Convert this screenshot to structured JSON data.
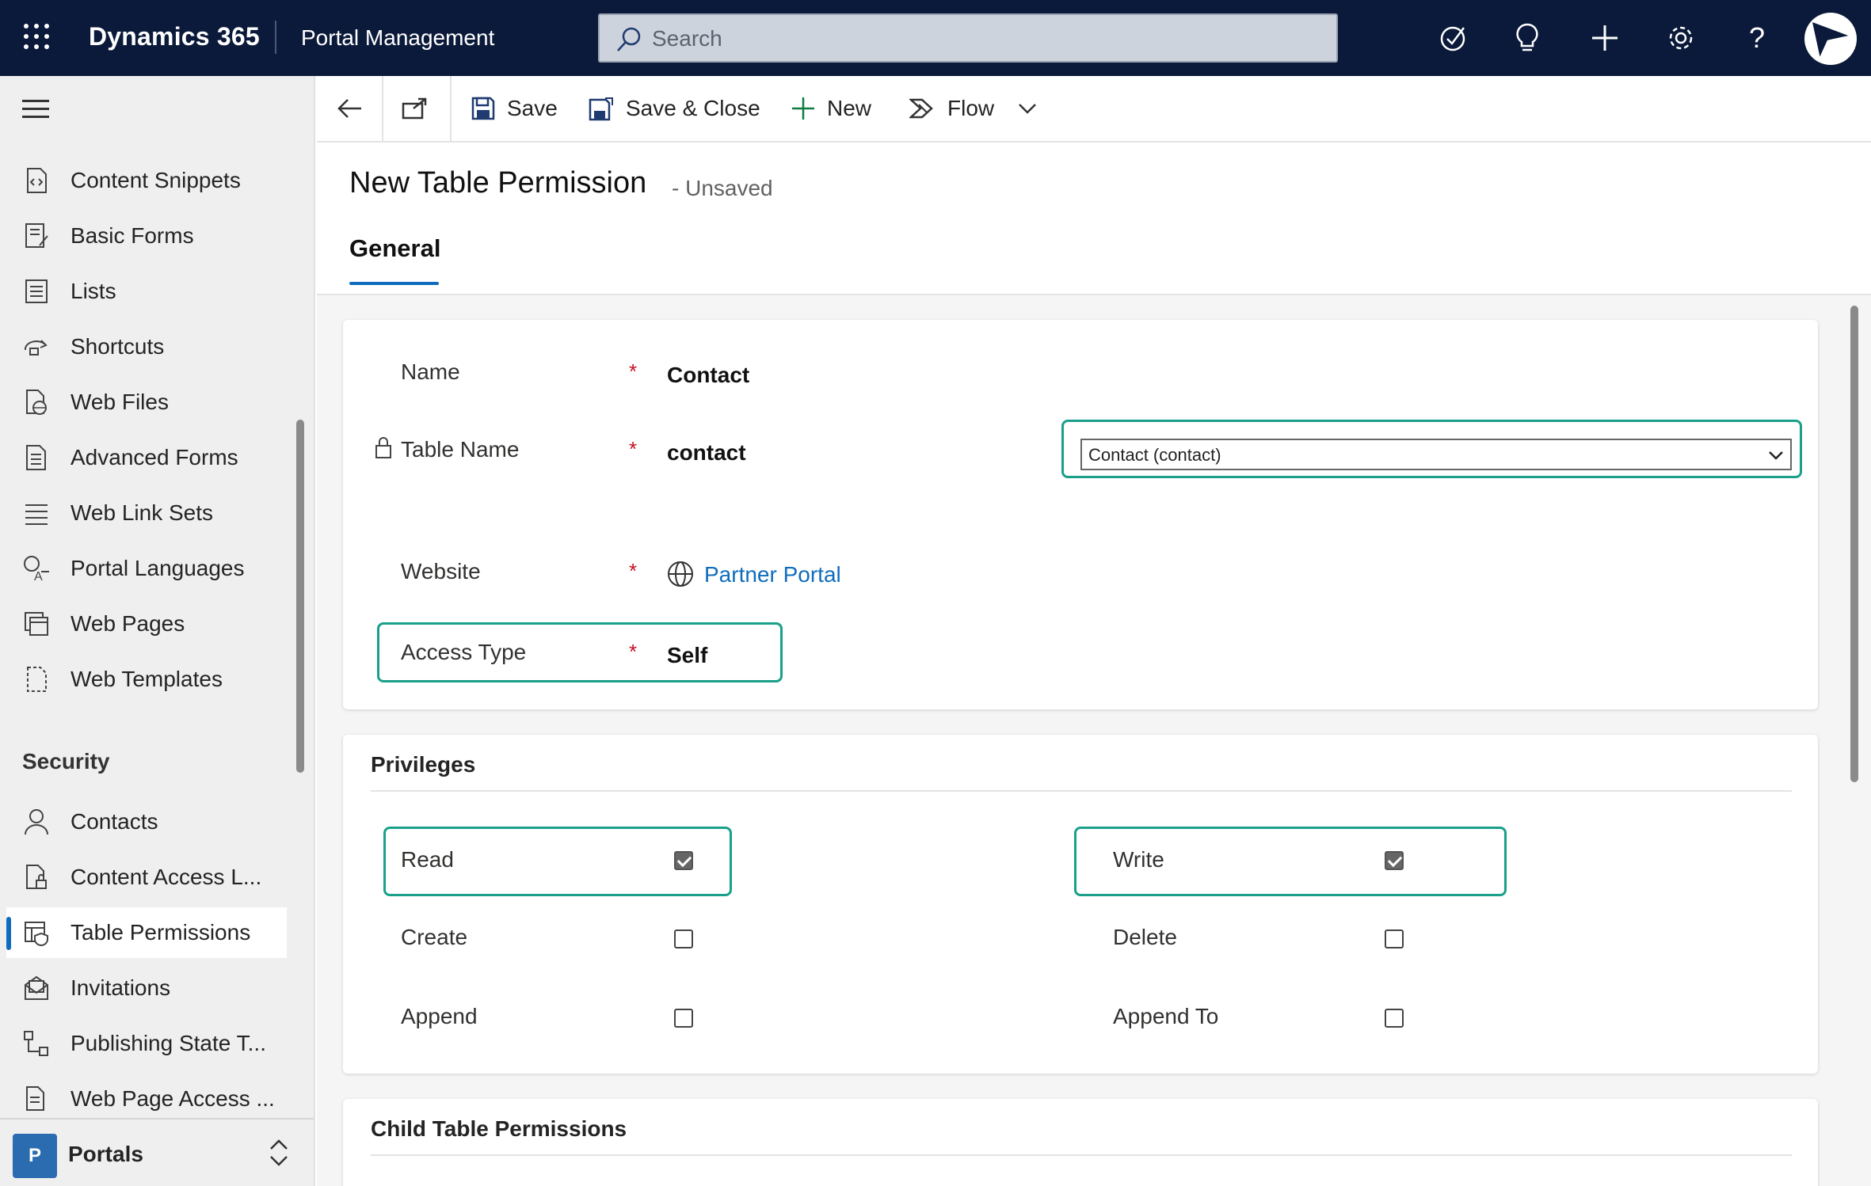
{
  "topbar": {
    "app_title": "Dynamics 365",
    "area_title": "Portal Management",
    "search_placeholder": "Search",
    "icons": [
      "waffle-icon",
      "search-icon",
      "task-check-icon",
      "lightbulb-icon",
      "plus-icon",
      "gear-icon",
      "help-icon",
      "user-avatar-logo"
    ],
    "background": "#0b1a3a"
  },
  "sidebar": {
    "items": [
      {
        "label": "Content Snippets",
        "icon": "content-snippet-icon"
      },
      {
        "label": "Basic Forms",
        "icon": "form-icon"
      },
      {
        "label": "Lists",
        "icon": "list-icon"
      },
      {
        "label": "Shortcuts",
        "icon": "shortcut-icon"
      },
      {
        "label": "Web Files",
        "icon": "web-file-icon"
      },
      {
        "label": "Advanced Forms",
        "icon": "advanced-form-icon"
      },
      {
        "label": "Web Link Sets",
        "icon": "link-set-icon"
      },
      {
        "label": "Portal Languages",
        "icon": "language-icon"
      },
      {
        "label": "Web Pages",
        "icon": "web-pages-icon"
      },
      {
        "label": "Web Templates",
        "icon": "template-icon"
      }
    ],
    "security_heading": "Security",
    "security_items": [
      {
        "label": "Contacts",
        "icon": "person-icon"
      },
      {
        "label": "Content Access L...",
        "icon": "content-access-icon"
      },
      {
        "label": "Table Permissions",
        "icon": "table-permission-icon",
        "selected": true
      },
      {
        "label": "Invitations",
        "icon": "invitation-icon"
      },
      {
        "label": "Publishing State T...",
        "icon": "publishing-state-icon"
      },
      {
        "label": "Web Page Access ...",
        "icon": "page-access-icon"
      }
    ],
    "area": {
      "badge": "P",
      "name": "Portals"
    }
  },
  "commandbar": {
    "save": "Save",
    "save_close": "Save & Close",
    "new": "New",
    "flow": "Flow"
  },
  "form": {
    "title": "New Table Permission",
    "status": "- Unsaved",
    "tab": "General",
    "fields": {
      "name_label": "Name",
      "name_value": "Contact",
      "table_label": "Table Name",
      "table_value": "contact",
      "table_select": "Contact (contact)",
      "website_label": "Website",
      "website_value": "Partner Portal",
      "access_label": "Access Type",
      "access_value": "Self",
      "required_mark": "*"
    },
    "privileges": {
      "title": "Privileges",
      "read": {
        "label": "Read",
        "checked": true
      },
      "write": {
        "label": "Write",
        "checked": true
      },
      "create": {
        "label": "Create",
        "checked": false
      },
      "delete": {
        "label": "Delete",
        "checked": false
      },
      "append": {
        "label": "Append",
        "checked": false
      },
      "append_to": {
        "label": "Append To",
        "checked": false
      }
    },
    "child_title": "Child Table Permissions"
  },
  "colors": {
    "accent": "#0f6cbd",
    "highlight": "#1aa08a",
    "required": "#c50f1f"
  }
}
